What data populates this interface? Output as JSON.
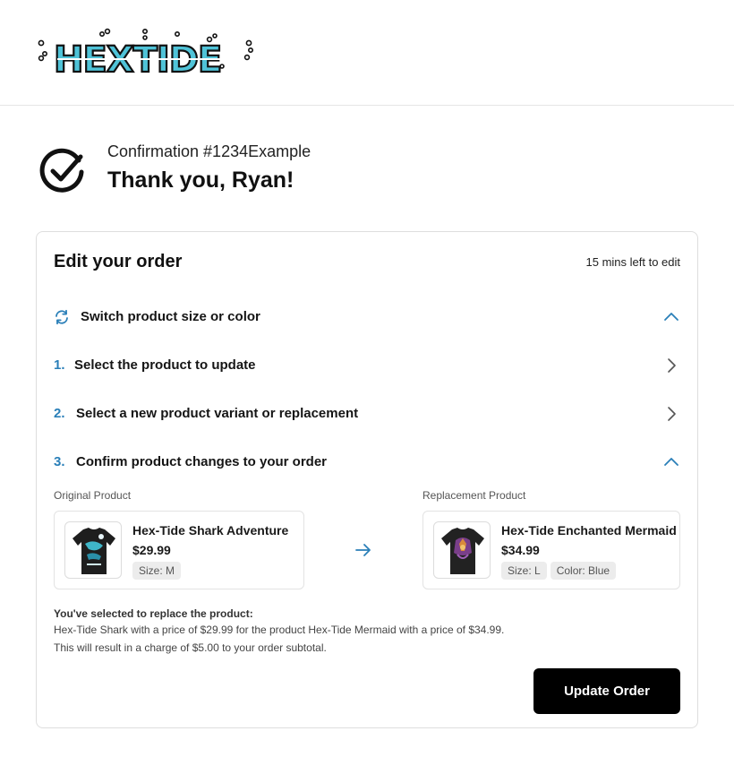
{
  "brand": {
    "logo_text": "HEXTIDE"
  },
  "confirmation": {
    "number_text": "Confirmation #1234Example",
    "thanks_text": "Thank you, Ryan!"
  },
  "edit_order": {
    "title": "Edit your order",
    "time_left": "15 mins left to edit",
    "section": {
      "label": "Switch product size or color"
    },
    "steps": [
      {
        "number": "1.",
        "label": "Select the product to update"
      },
      {
        "number": "2.",
        "label": "Select a new product variant or replacement"
      },
      {
        "number": "3.",
        "label": "Confirm product changes to your order"
      }
    ],
    "original": {
      "heading": "Original Product",
      "name": "Hex-Tide Shark Adventure",
      "price": "$29.99",
      "tags": [
        "Size: M"
      ]
    },
    "replacement": {
      "heading": "Replacement Product",
      "name": "Hex-Tide Enchanted Mermaid",
      "price": "$34.99",
      "tags": [
        "Size: L",
        "Color: Blue"
      ]
    },
    "summary": {
      "title": "You've selected to replace the product:",
      "line1": "Hex-Tide Shark with a price of $29.99 for the product Hex-Tide Mermaid with a price of $34.99.",
      "line2": "This will result in a charge of $5.00 to your order subtotal."
    },
    "update_button": "Update Order"
  },
  "colors": {
    "accent": "#2a7fb8",
    "logo_teal": "#4fc3d8",
    "button_bg": "#000000"
  },
  "icons": [
    "check-circle-icon",
    "sync-icon",
    "chevron-up-icon",
    "chevron-right-icon",
    "arrow-right-icon"
  ]
}
